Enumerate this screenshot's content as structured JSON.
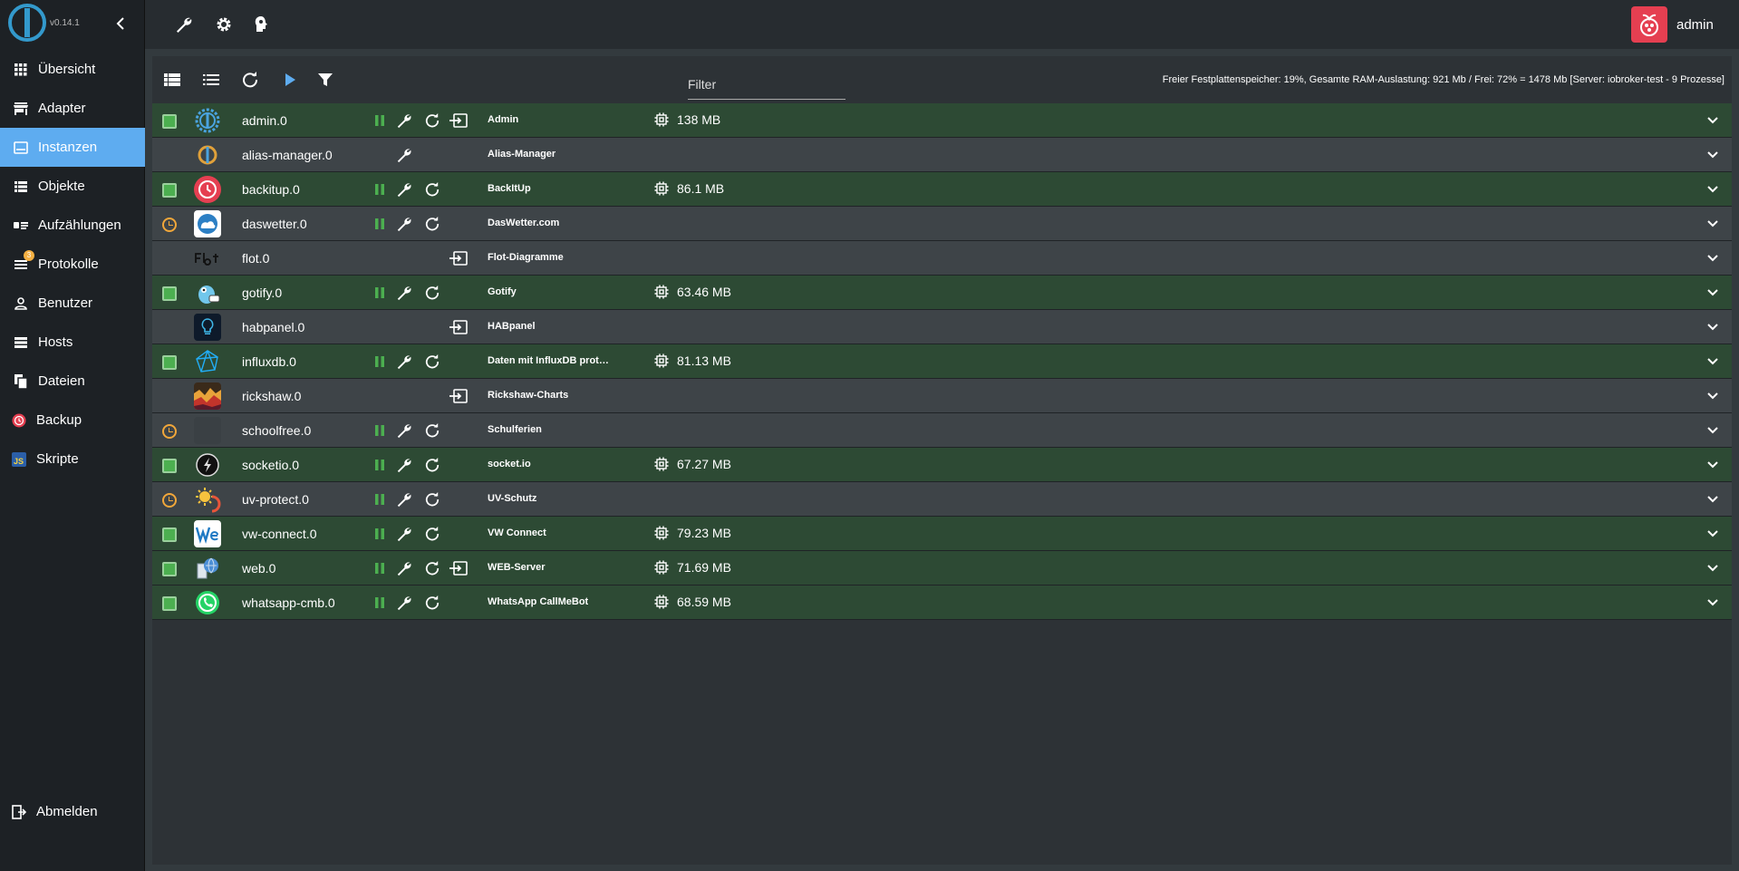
{
  "app": {
    "version": "v0.14.1",
    "user": "admin"
  },
  "sidebar": {
    "items": [
      {
        "label": "Übersicht",
        "icon": "grid-icon"
      },
      {
        "label": "Adapter",
        "icon": "store-icon"
      },
      {
        "label": "Instanzen",
        "icon": "instances-icon",
        "active": true
      },
      {
        "label": "Objekte",
        "icon": "list-icon"
      },
      {
        "label": "Aufzählungen",
        "icon": "enum-icon"
      },
      {
        "label": "Protokolle",
        "icon": "log-icon",
        "badge": "3"
      },
      {
        "label": "Benutzer",
        "icon": "user-icon"
      },
      {
        "label": "Hosts",
        "icon": "hosts-icon"
      },
      {
        "label": "Dateien",
        "icon": "files-icon"
      },
      {
        "label": "Backup",
        "icon": "backup-icon"
      },
      {
        "label": "Skripte",
        "icon": "js-icon"
      }
    ],
    "logout": "Abmelden"
  },
  "toolbar": {
    "filter_placeholder": "Filter",
    "status": "Freier Festplattenspeicher: 19%, Gesamte RAM-Auslastung: 921 Mb / Frei: 72% = 1478 Mb [Server: iobroker-test - 9 Prozesse]"
  },
  "colors": {
    "accent": "#5eacf0",
    "running_row": "#2d4a34",
    "stopped_row": "#3e4448",
    "state_green": "#4caf50",
    "state_scheduled": "#f1a73a"
  },
  "instances": [
    {
      "name": "admin.0",
      "title": "Admin",
      "memory": "138 MB",
      "state": "running",
      "controls": [
        "pause",
        "wrench",
        "restart",
        "open"
      ]
    },
    {
      "name": "alias-manager.0",
      "title": "Alias-Manager",
      "memory": "",
      "state": "none",
      "controls": [
        "wrench"
      ]
    },
    {
      "name": "backitup.0",
      "title": "BackItUp",
      "memory": "86.1 MB",
      "state": "running",
      "controls": [
        "pause",
        "wrench",
        "restart"
      ]
    },
    {
      "name": "daswetter.0",
      "title": "DasWetter.com",
      "memory": "",
      "state": "scheduled",
      "controls": [
        "pause",
        "wrench",
        "restart"
      ]
    },
    {
      "name": "flot.0",
      "title": "Flot-Diagramme",
      "memory": "",
      "state": "none",
      "controls": [
        "open"
      ]
    },
    {
      "name": "gotify.0",
      "title": "Gotify",
      "memory": "63.46 MB",
      "state": "running",
      "controls": [
        "pause",
        "wrench",
        "restart"
      ]
    },
    {
      "name": "habpanel.0",
      "title": "HABpanel",
      "memory": "",
      "state": "none",
      "controls": [
        "open"
      ]
    },
    {
      "name": "influxdb.0",
      "title": "Daten mit InfluxDB protok...",
      "memory": "81.13 MB",
      "state": "running",
      "controls": [
        "pause",
        "wrench",
        "restart"
      ]
    },
    {
      "name": "rickshaw.0",
      "title": "Rickshaw-Charts",
      "memory": "",
      "state": "none",
      "controls": [
        "open"
      ]
    },
    {
      "name": "schoolfree.0",
      "title": "Schulferien",
      "memory": "",
      "state": "scheduled",
      "controls": [
        "pause",
        "wrench",
        "restart"
      ]
    },
    {
      "name": "socketio.0",
      "title": "socket.io",
      "memory": "67.27 MB",
      "state": "running",
      "controls": [
        "pause",
        "wrench",
        "restart"
      ]
    },
    {
      "name": "uv-protect.0",
      "title": "UV-Schutz",
      "memory": "",
      "state": "scheduled",
      "controls": [
        "pause",
        "wrench",
        "restart"
      ]
    },
    {
      "name": "vw-connect.0",
      "title": "VW Connect",
      "memory": "79.23 MB",
      "state": "running",
      "controls": [
        "pause",
        "wrench",
        "restart"
      ]
    },
    {
      "name": "web.0",
      "title": "WEB-Server",
      "memory": "71.69 MB",
      "state": "running",
      "controls": [
        "pause",
        "wrench",
        "restart",
        "open"
      ]
    },
    {
      "name": "whatsapp-cmb.0",
      "title": "WhatsApp CallMeBot",
      "memory": "68.59 MB",
      "state": "running",
      "controls": [
        "pause",
        "wrench",
        "restart"
      ]
    }
  ]
}
